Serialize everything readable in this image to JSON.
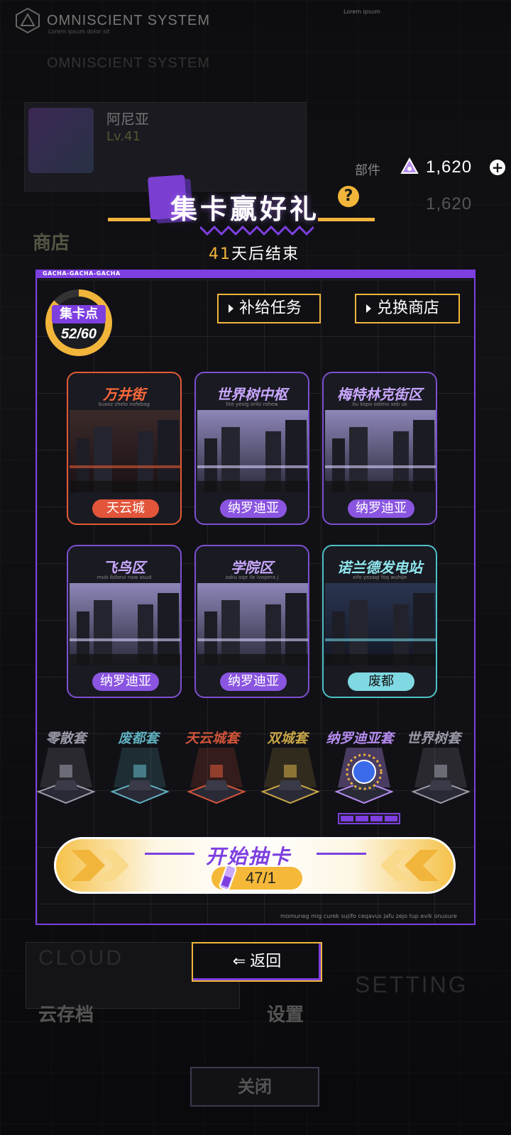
{
  "background": {
    "system_title": "OMNISCIENT SYSTEM",
    "system_sub": "Lorem ipsum dolor sit",
    "system_title_ghost": "OMNISCIENT SYSTEM",
    "top_right_text": "Lorem ipsum",
    "profile_name": "阿尼亚",
    "profile_level": "Lv.41",
    "parts_label": "部件",
    "shop_label": "商店",
    "cloud_en": "CLOUD",
    "cloud_cn": "云存档",
    "setting_en": "SETTING",
    "setting_cn": "设置",
    "close_label": "关闭",
    "currency_ghost": "1,620"
  },
  "currency": {
    "value": "1,620",
    "icon": "triangle-gem-icon"
  },
  "header": {
    "title": "集卡赢好礼",
    "help_icon": "question-icon",
    "help_symbol": "?",
    "days_left": "41",
    "days_suffix": "天后结束"
  },
  "panel": {
    "tag": "GACHA-GACHA-GACHA",
    "footer_text": "momuneg mig curek sujifo ceqavus jafu zejo tup evik onusure",
    "points_label": "集卡点",
    "points_value": "52/60",
    "points_current": 52,
    "points_max": 60,
    "supply_button": "补给任务",
    "exchange_button": "兑换商店"
  },
  "cards": [
    {
      "title": "万井街",
      "sub": "kuxoz zhelo nofebag",
      "region": "天云城",
      "theme": "red"
    },
    {
      "title": "世界树中枢",
      "sub": "tite yesig orilo rohew",
      "region": "纳罗迪亚",
      "theme": "purple"
    },
    {
      "title": "梅特林克街区",
      "sub": "itu kopo odimo xeb uk",
      "region": "纳罗迪亚",
      "theme": "purple"
    },
    {
      "title": "飞鸟区",
      "sub": "mub ibibevi naw asud",
      "region": "纳罗迪亚",
      "theme": "purple"
    },
    {
      "title": "学院区",
      "sub": "zaku oqe ile ivopera j",
      "region": "纳罗迪亚",
      "theme": "purple"
    },
    {
      "title": "诺兰德发电站",
      "sub": "xifo yezaqi foq wuhije",
      "region": "废都",
      "theme": "cyan"
    }
  ],
  "sets": [
    {
      "label": "零散套",
      "color": "#9a9aa8"
    },
    {
      "label": "废都套",
      "color": "#5fb0c0"
    },
    {
      "label": "天云城套",
      "color": "#d2553a"
    },
    {
      "label": "双城套",
      "color": "#c9a648"
    },
    {
      "label": "纳罗迪亚套",
      "color": "#b58cf0"
    },
    {
      "label": "世界树套",
      "color": "#9a9aa8"
    }
  ],
  "selected_set_progress": "4/4",
  "draw": {
    "label": "开始抽卡",
    "ticket_value": "47/1"
  },
  "back_button": "返回",
  "colors": {
    "accent_purple": "#7d3fe0",
    "accent_gold": "#f2b53b",
    "red": "#e25a34",
    "cyan": "#4ec0c8"
  }
}
